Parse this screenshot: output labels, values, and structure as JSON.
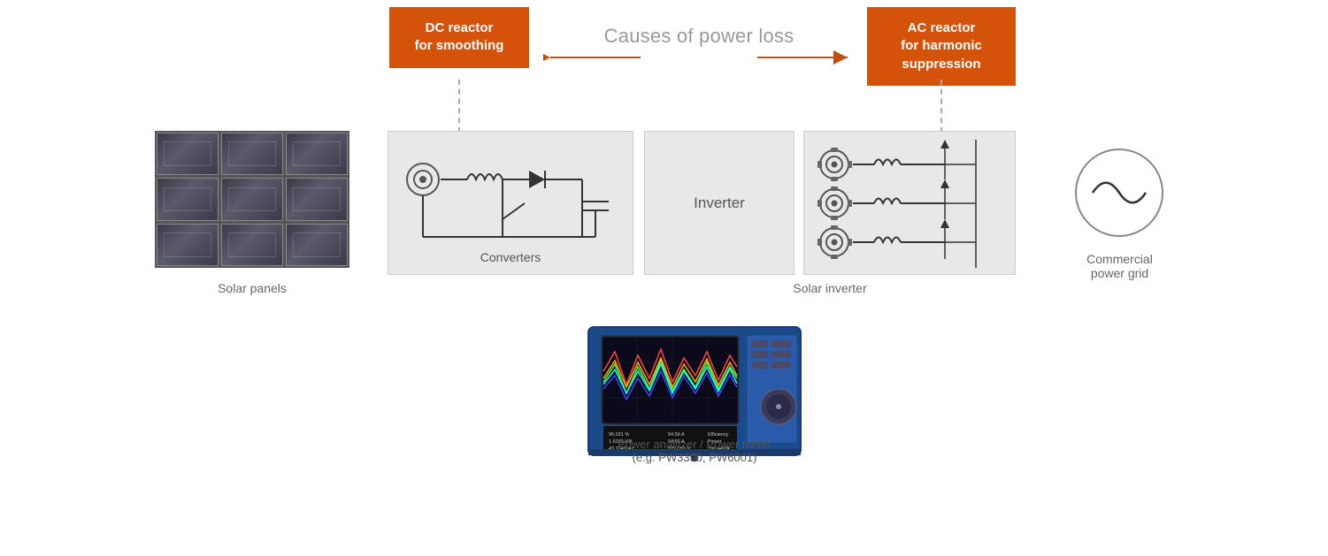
{
  "header": {
    "causes_label": "Causes of power loss"
  },
  "boxes": {
    "dc_reactor": {
      "line1": "DC reactor",
      "line2": "for smoothing"
    },
    "ac_reactor": {
      "line1": "AC reactor",
      "line2": "for harmonic",
      "line3": "suppression"
    }
  },
  "components": {
    "solar_panels": {
      "label": "Solar panels"
    },
    "converters": {
      "label": "Converters"
    },
    "inverter": {
      "label": "Inverter"
    },
    "solar_inverter": {
      "label": "Solar inverter"
    },
    "commercial_grid": {
      "line1": "Commercial",
      "line2": "power grid"
    }
  },
  "analyzer": {
    "label_line1": "Power analyzer / Power meter",
    "label_line2": "(e.g. PW3390, PW6001)"
  },
  "colors": {
    "orange": "#d4520a",
    "gray_text": "#888888",
    "dark_gray": "#555555",
    "light_bg": "#e8e8e8"
  }
}
